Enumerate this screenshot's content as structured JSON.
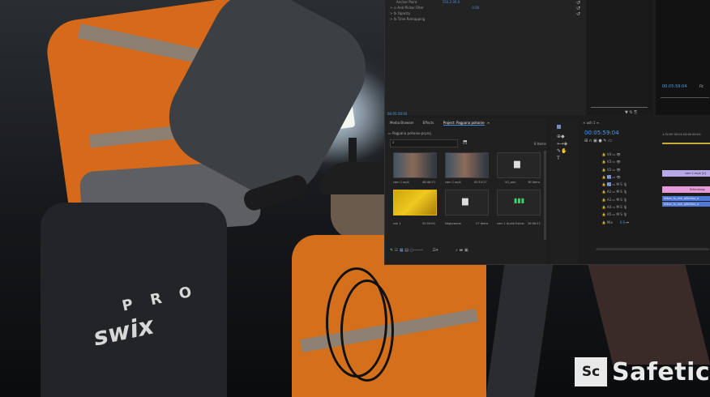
{
  "photo": {
    "brand_top": "P R O",
    "brand_bottom": "swix"
  },
  "premiere": {
    "effects": {
      "rows": [
        {
          "label": "Anchor Point",
          "value": "150.2   90.0"
        },
        {
          "label": "Anti-flicker Filter",
          "value": "0.00"
        },
        {
          "label": "Opacity",
          "value": ""
        },
        {
          "label": "Time Remapping",
          "value": ""
        }
      ]
    },
    "source_timecode": "00:05:59:04",
    "program_timecode": "00:05:59:04",
    "program_label": "Fit",
    "project": {
      "tabs": [
        "Media Browser",
        "Effects",
        "Project: Pagpana pohanie"
      ],
      "folder": "Pagpana pohanie.prproj",
      "item_count": "8 Items",
      "items": [
        {
          "name": "cam 2.mp4",
          "duration": "48:46:23",
          "kind": "video"
        },
        {
          "name": "cam 2.mp4",
          "duration": "05:10:27",
          "kind": "video"
        },
        {
          "name": "VO_pan",
          "duration": "38 Items",
          "kind": "bin"
        },
        {
          "name": "ush 1",
          "duration": "05:59:04",
          "kind": "sequence"
        },
        {
          "name": "Nagrywane",
          "duration": "27 Items",
          "kind": "bin"
        },
        {
          "name": "cam 1 Audio Extrac",
          "duration": "26:56:23",
          "kind": "audio"
        }
      ]
    },
    "timeline": {
      "tab": "ush 1",
      "timecode": "00:05:59:04",
      "ruler": [
        "1:32:00",
        "00:01:04:00",
        "00:01:"
      ],
      "clips": [
        "cam 1.mp4 [V]",
        "Schindung",
        "Nikon_fx_dxk_bjNirKoo_a",
        "Nikon_fx_dxk_bjNirKoo_a"
      ],
      "master": "Mix",
      "master_value": "0.0"
    },
    "accent_color": "#4a8bd6"
  },
  "watermark": {
    "mark": "Sc",
    "name": "Safetic"
  }
}
